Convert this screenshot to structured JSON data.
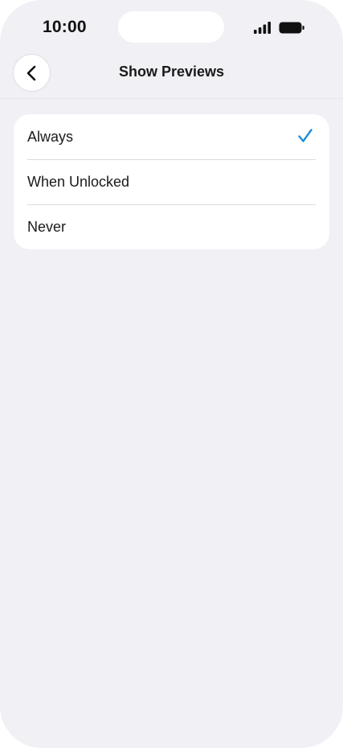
{
  "status_bar": {
    "time": "10:00",
    "signal_icon": "cellular-signal-icon",
    "battery_icon": "battery-full-icon"
  },
  "header": {
    "title": "Show Previews",
    "back_icon": "chevron-left-icon"
  },
  "options": [
    {
      "label": "Always",
      "selected": true
    },
    {
      "label": "When Unlocked",
      "selected": false
    },
    {
      "label": "Never",
      "selected": false
    }
  ],
  "colors": {
    "accent": "#1a8fd8",
    "background": "#f0f0f5",
    "card": "#ffffff"
  },
  "icons": {
    "selected_marker": "checkmark-icon"
  }
}
